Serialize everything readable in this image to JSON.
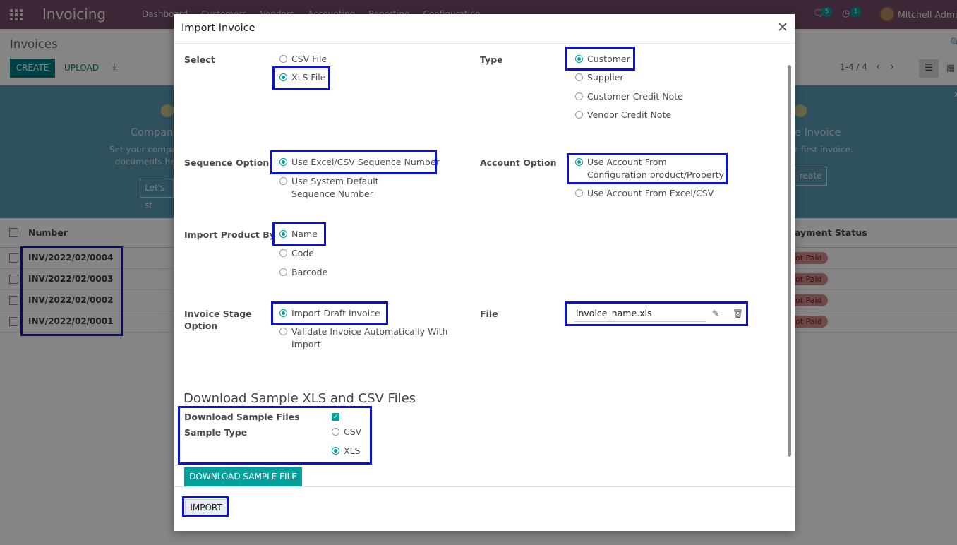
{
  "app": {
    "name": "Invoicing",
    "menu": [
      "Dashboard",
      "Customers",
      "Vendors",
      "Accounting",
      "Reporting",
      "Configuration"
    ],
    "messages_count": "5",
    "activities_count": "1",
    "user": "Mitchell Admin"
  },
  "control_panel": {
    "title": "Invoices",
    "create_label": "CREATE",
    "upload_label": "UPLOAD",
    "pager": "1-4 / 4"
  },
  "banner": {
    "left_title": "Company",
    "left_text": "Set your compa",
    "left_text2": "documents he",
    "left_button": "Let's st",
    "right_title": "e Invoice",
    "right_text": "r first invoice.",
    "right_button": "reate"
  },
  "list": {
    "col_number": "Number",
    "col_payment": "ayment Status",
    "rows": [
      {
        "number": "INV/2022/02/0004",
        "status": "lot Paid"
      },
      {
        "number": "INV/2022/02/0003",
        "status": "lot Paid"
      },
      {
        "number": "INV/2022/02/0002",
        "status": "lot Paid"
      },
      {
        "number": "INV/2022/02/0001",
        "status": "lot Paid"
      }
    ]
  },
  "dialog": {
    "title": "Import Invoice",
    "select": {
      "label": "Select",
      "options": [
        "CSV File",
        "XLS File"
      ],
      "selected": "XLS File"
    },
    "type": {
      "label": "Type",
      "options": [
        "Customer",
        "Supplier",
        "Customer Credit Note",
        "Vendor Credit Note"
      ],
      "selected": "Customer"
    },
    "sequence": {
      "label": "Sequence Option",
      "options": [
        "Use Excel/CSV Sequence Number",
        "Use System Default Sequence Number"
      ],
      "selected": "Use Excel/CSV Sequence Number"
    },
    "account": {
      "label": "Account Option",
      "options": [
        "Use Account From Configuration product/Property",
        "Use Account From Excel/CSV"
      ],
      "selected": "Use Account From Configuration product/Property"
    },
    "product": {
      "label": "Import Product By",
      "options": [
        "Name",
        "Code",
        "Barcode"
      ],
      "selected": "Name"
    },
    "stage": {
      "label": "Invoice Stage Option",
      "options": [
        "Import Draft Invoice",
        "Validate Invoice Automatically With Import"
      ],
      "selected": "Import Draft Invoice"
    },
    "file": {
      "label": "File",
      "value": "invoice_name.xls"
    },
    "sample": {
      "section_title": "Download Sample XLS and CSV Files",
      "download_label": "Download Sample Files",
      "download_checked": true,
      "type_label": "Sample Type",
      "options": [
        "CSV",
        "XLS"
      ],
      "selected": "XLS",
      "button": "DOWNLOAD SAMPLE FILE"
    },
    "import_button": "IMPORT"
  },
  "colors": {
    "primary": "#00a09d",
    "navbar": "#714b67",
    "highlight": "#0b12d6"
  }
}
